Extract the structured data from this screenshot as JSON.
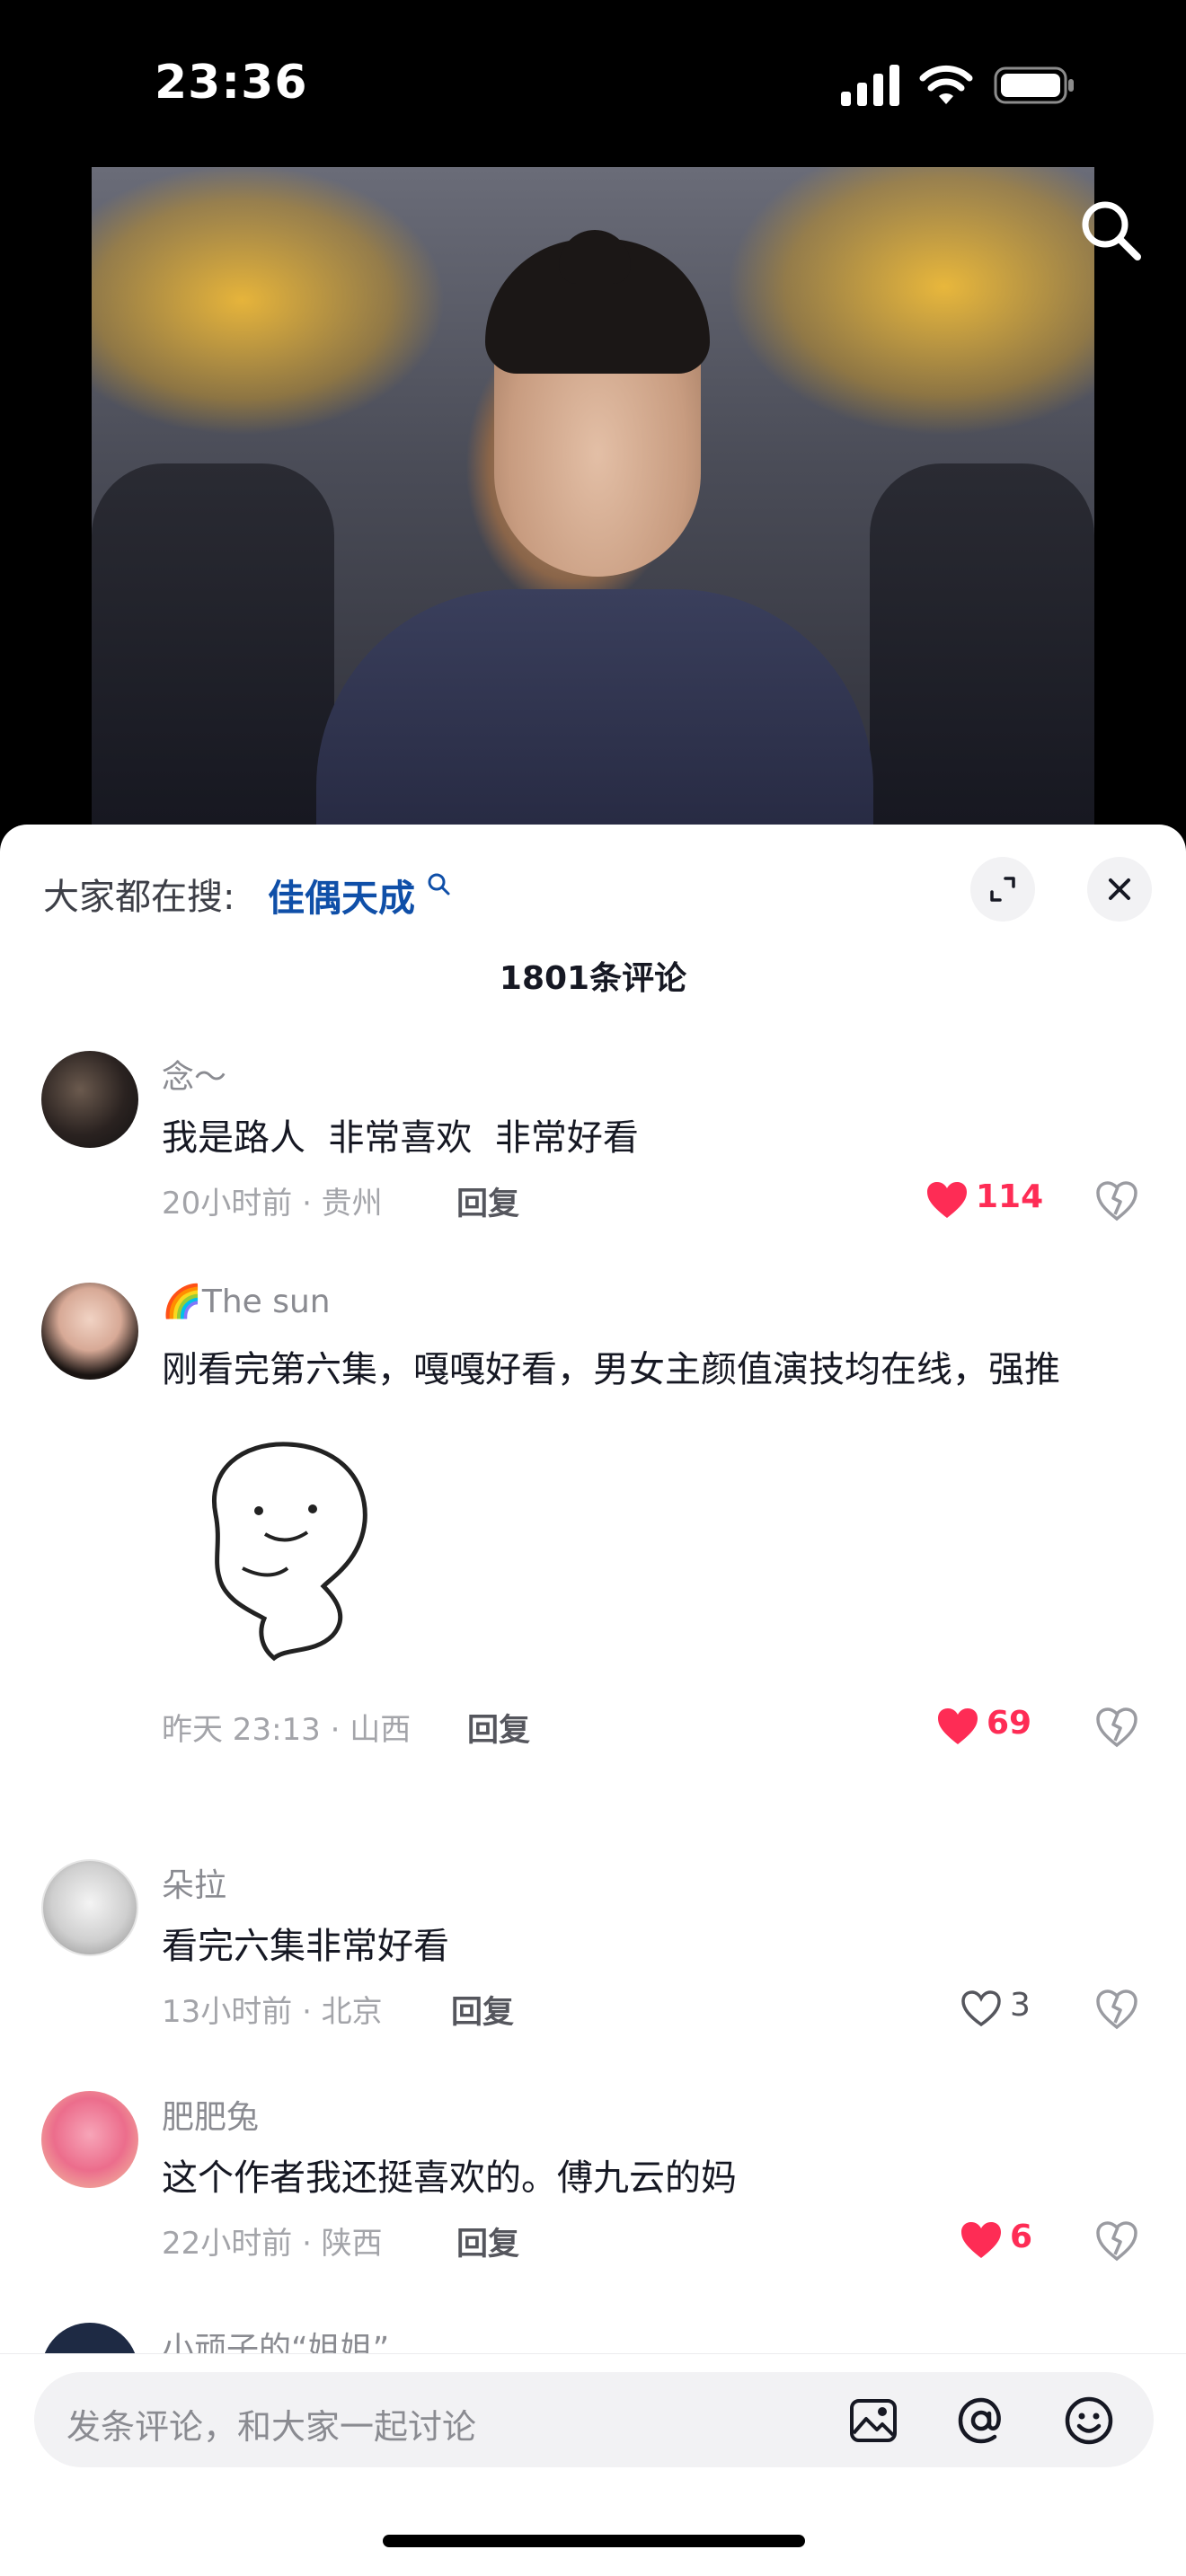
{
  "status_bar": {
    "time": "23:36",
    "icons": [
      "cellular-signal-icon",
      "wifi-icon",
      "battery-icon"
    ]
  },
  "video": {
    "overlay_icons": [
      "search-icon"
    ]
  },
  "sheet": {
    "trending_prefix": "大家都在搜:",
    "trending_term": "佳偶天成",
    "comment_count_label": "1801条评论",
    "header_icons": [
      "expand-icon",
      "close-icon"
    ]
  },
  "comments": [
    {
      "username": "念～",
      "text": "我是路人  非常喜欢  非常好看",
      "meta": "20小时前 · 贵州",
      "reply_label": "回复",
      "likes": "114",
      "liked": true
    },
    {
      "username": "🌈The sun",
      "text": "刚看完第六集，嘎嘎好看，男女主颜值演技均在线，强推",
      "meta": "昨天 23:13 · 山西",
      "reply_label": "回复",
      "likes": "69",
      "liked": true,
      "has_sticker": true
    },
    {
      "username": "朵拉",
      "text": "看完六集非常好看",
      "meta": "13小时前 · 北京",
      "reply_label": "回复",
      "likes": "3",
      "liked": false
    },
    {
      "username": "肥肥兔",
      "text": "这个作者我还挺喜欢的。傅九云的妈",
      "meta": "22小时前 · 陕西",
      "reply_label": "回复",
      "likes": "6",
      "liked": true
    },
    {
      "username": "小顽子的“姐姐”"
    }
  ],
  "input_bar": {
    "placeholder": "发条评论，和大家一起讨论",
    "icons": [
      "image-icon",
      "at-mention-icon",
      "emoji-icon"
    ]
  },
  "colors": {
    "accent_like": "#fe2c55",
    "trending_link": "#0f4fa8"
  }
}
